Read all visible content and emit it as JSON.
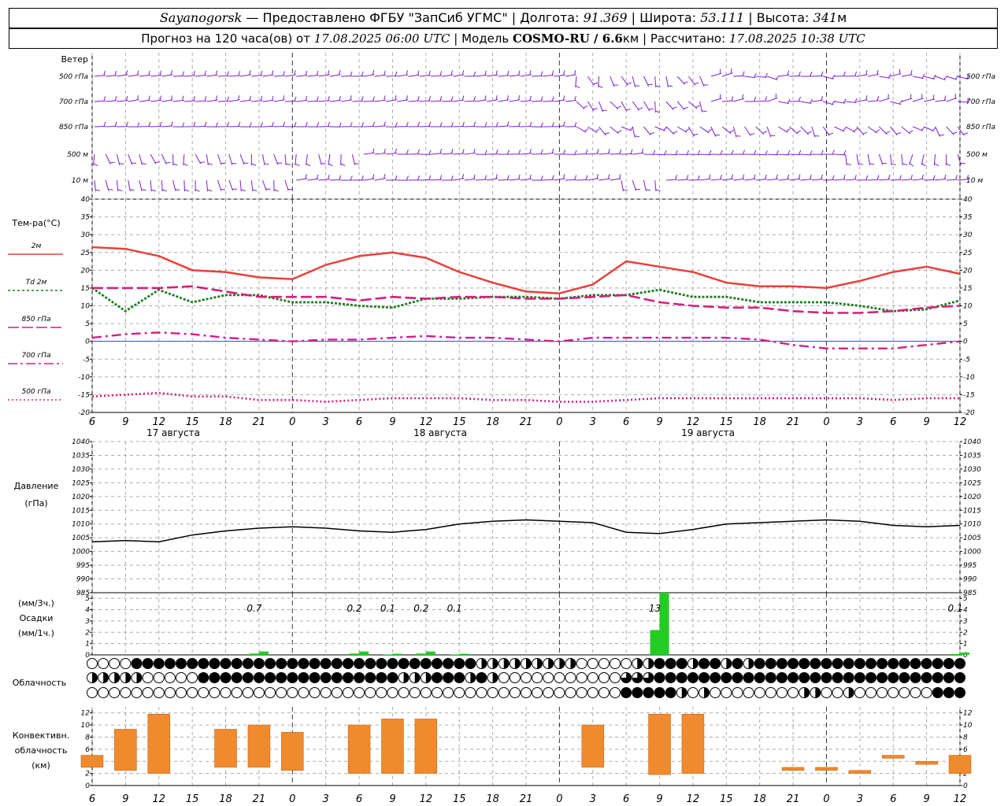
{
  "header": {
    "station": "Sayanogorsk",
    "provider": " — Предоставлено ФГБУ \"ЗапСиб УГМС\" | Долгота: ",
    "lon": "91.369",
    "lat_label": " | Широта: ",
    "lat": "53.111",
    "alt_label": " | Высота: ",
    "alt": "341",
    "alt_unit": "м",
    "forecast_label": "Прогноз на 120 часа(ов) от ",
    "forecast_start": "17.08.2025 06:00 UTC",
    "model_label": " | Модель ",
    "model": "COSMO-RU / 6.6",
    "model_unit": "км",
    "calc_label": " | Рассчитано: ",
    "calc_time": "17.08.2025 10:38 UTC"
  },
  "time_axis": {
    "hours": [
      "6",
      "9",
      "12",
      "15",
      "18",
      "21",
      "0",
      "3",
      "6",
      "9",
      "12",
      "15",
      "18",
      "21",
      "0",
      "3",
      "6",
      "9",
      "12",
      "15",
      "18",
      "21",
      "0",
      "3",
      "6",
      "9",
      "12"
    ],
    "days": [
      "17 августа",
      "18 августа",
      "19 августа"
    ]
  },
  "wind": {
    "title": "Ветер",
    "levels": [
      "500 гПа",
      "700 гПа",
      "850 гПа",
      "500 м",
      "10  м"
    ],
    "color": "#7a1fd6"
  },
  "temperature": {
    "title": "Тем-ра(°С)",
    "legend": [
      "2м",
      "Td  2м",
      "850 гПа",
      "700 гПа",
      "500 гПа"
    ],
    "yticks": [
      "40",
      "35",
      "30",
      "25",
      "20",
      "15",
      "10",
      "5",
      "0",
      "-5",
      "-10",
      "-15",
      "-20"
    ],
    "colors": {
      "t2m": "#e8413a",
      "td2m": "#1a7d1a",
      "t850": "#d4217a",
      "t700": "#d4217a",
      "t500": "#d4217a"
    }
  },
  "pressure": {
    "title1": "Давление",
    "title2": "(гПа)",
    "yticks": [
      "1040",
      "1035",
      "1030",
      "1025",
      "1020",
      "1015",
      "1010",
      "1005",
      "1000",
      "995",
      "990",
      "985"
    ]
  },
  "precip": {
    "title1": "(мм/3ч.)",
    "title2": "Осадки",
    "title3": "(мм/1ч.)",
    "yticks": [
      "5",
      "4",
      "3",
      "2",
      "1",
      "0"
    ],
    "labels": [
      "0.7",
      "0.2",
      "0.1",
      "0.2",
      "0.1",
      "13",
      "0.1"
    ]
  },
  "cloud": {
    "title": "Облачность"
  },
  "convective": {
    "title1": "Конвективн.",
    "title2": "облачность",
    "title3": "(км)",
    "yticks": [
      "12",
      "10",
      "8",
      "6",
      "4",
      "2",
      "0"
    ],
    "color": "#ef8a2e"
  },
  "chart_data": [
    {
      "type": "line",
      "title": "Тем-ра(°С)",
      "x_start": "17.08.2025 06:00 UTC",
      "x_step_hours": 3,
      "x_ticks": [
        "6",
        "9",
        "12",
        "15",
        "18",
        "21",
        "0",
        "3",
        "6",
        "9",
        "12",
        "15",
        "18",
        "21",
        "0",
        "3",
        "6",
        "9",
        "12",
        "15",
        "18",
        "21",
        "0",
        "3",
        "6",
        "9",
        "12"
      ],
      "ylim": [
        -20,
        40
      ],
      "series": [
        {
          "name": "2м",
          "values": [
            26.5,
            26.0,
            24.0,
            20.0,
            19.5,
            18.0,
            17.5,
            21.5,
            24.0,
            25.0,
            23.5,
            19.5,
            16.5,
            14.0,
            13.5,
            16.0,
            22.5,
            21.0,
            19.5,
            16.5,
            15.5,
            15.5,
            15.0,
            17.0,
            19.5,
            21.0,
            19.0
          ]
        },
        {
          "name": "Td  2м",
          "values": [
            15.0,
            8.5,
            14.5,
            11.0,
            13.0,
            13.0,
            11.0,
            11.0,
            10.0,
            9.5,
            12.0,
            12.0,
            12.5,
            12.5,
            12.0,
            13.0,
            13.0,
            14.5,
            12.5,
            12.5,
            11.0,
            11.0,
            11.0,
            10.0,
            8.5,
            9.0,
            11.5
          ]
        },
        {
          "name": "850 гПа",
          "values": [
            15.0,
            15.0,
            15.0,
            15.5,
            14.0,
            12.5,
            12.5,
            12.5,
            11.5,
            12.5,
            12.0,
            12.5,
            12.5,
            12.0,
            12.0,
            12.5,
            13.0,
            11.0,
            10.0,
            9.5,
            9.5,
            8.5,
            8.0,
            8.0,
            8.5,
            9.5,
            10.0
          ]
        },
        {
          "name": "700 гПа",
          "values": [
            1.0,
            2.0,
            2.5,
            2.0,
            1.0,
            0.5,
            0.0,
            0.5,
            0.5,
            1.0,
            1.5,
            1.0,
            1.0,
            0.5,
            0.0,
            1.0,
            1.0,
            1.0,
            1.0,
            1.0,
            0.5,
            -1.0,
            -2.0,
            -2.0,
            -2.0,
            -1.0,
            0.0
          ]
        },
        {
          "name": "500 гПа",
          "values": [
            -15.5,
            -15.0,
            -14.5,
            -15.5,
            -15.5,
            -16.5,
            -16.5,
            -17.0,
            -16.5,
            -16.0,
            -16.0,
            -16.0,
            -16.5,
            -16.5,
            -17.0,
            -17.0,
            -16.5,
            -16.0,
            -16.0,
            -16.0,
            -16.0,
            -16.0,
            -16.0,
            -16.0,
            -16.5,
            -16.0,
            -16.0
          ]
        }
      ]
    },
    {
      "type": "line",
      "title": "Давление",
      "x_step_hours": 3,
      "ylim": [
        985,
        1040
      ],
      "series": [
        {
          "name": "Давление",
          "values": [
            1003.5,
            1004.0,
            1003.5,
            1006.0,
            1007.5,
            1008.5,
            1009.0,
            1008.5,
            1007.5,
            1007.0,
            1008.0,
            1010.0,
            1011.0,
            1011.5,
            1011.0,
            1010.5,
            1007.0,
            1006.5,
            1008.0,
            1010.0,
            1010.5,
            1011.0,
            1011.5,
            1011.0,
            1009.5,
            1009.0,
            1009.5
          ]
        }
      ]
    },
    {
      "type": "bar",
      "title": "Осадки",
      "x_step_hours": 3,
      "ylim": [
        0,
        5.5
      ],
      "values": [
        0,
        0,
        0,
        0,
        0,
        0.3,
        0,
        0,
        0.3,
        0.1,
        0.3,
        0.1,
        0,
        0,
        0,
        0,
        0,
        5.5,
        0,
        0,
        0,
        0,
        0,
        0,
        0,
        0,
        0.2
      ],
      "labels": [
        "",
        "",
        "",
        "",
        "",
        "0.7",
        "",
        "",
        "0.2",
        "0.1",
        "0.2",
        "0.1",
        "",
        "",
        "",
        "",
        "",
        "13",
        "",
        "",
        "",
        "",
        "",
        "",
        "",
        "",
        "0.1"
      ]
    },
    {
      "type": "bar",
      "title": "Конвективн. облачность (км)",
      "x_step_hours": 3,
      "ylim": [
        0,
        13
      ],
      "top_km": [
        5.0,
        9.3,
        11.8,
        0,
        9.3,
        10.0,
        8.8,
        0,
        10.0,
        11.0,
        11.0,
        0,
        0,
        0,
        0,
        10.0,
        0,
        11.8,
        11.8,
        0,
        0,
        3.0,
        3.0,
        2.5,
        5.0,
        4.0,
        5.0
      ],
      "base_km": [
        3.0,
        2.5,
        2.0,
        0,
        3.0,
        3.0,
        2.5,
        0,
        2.0,
        2.0,
        2.0,
        0,
        0,
        0,
        0,
        3.0,
        0,
        1.8,
        2.0,
        0,
        0,
        2.5,
        2.5,
        2.0,
        4.5,
        3.5,
        2.0
      ]
    }
  ]
}
